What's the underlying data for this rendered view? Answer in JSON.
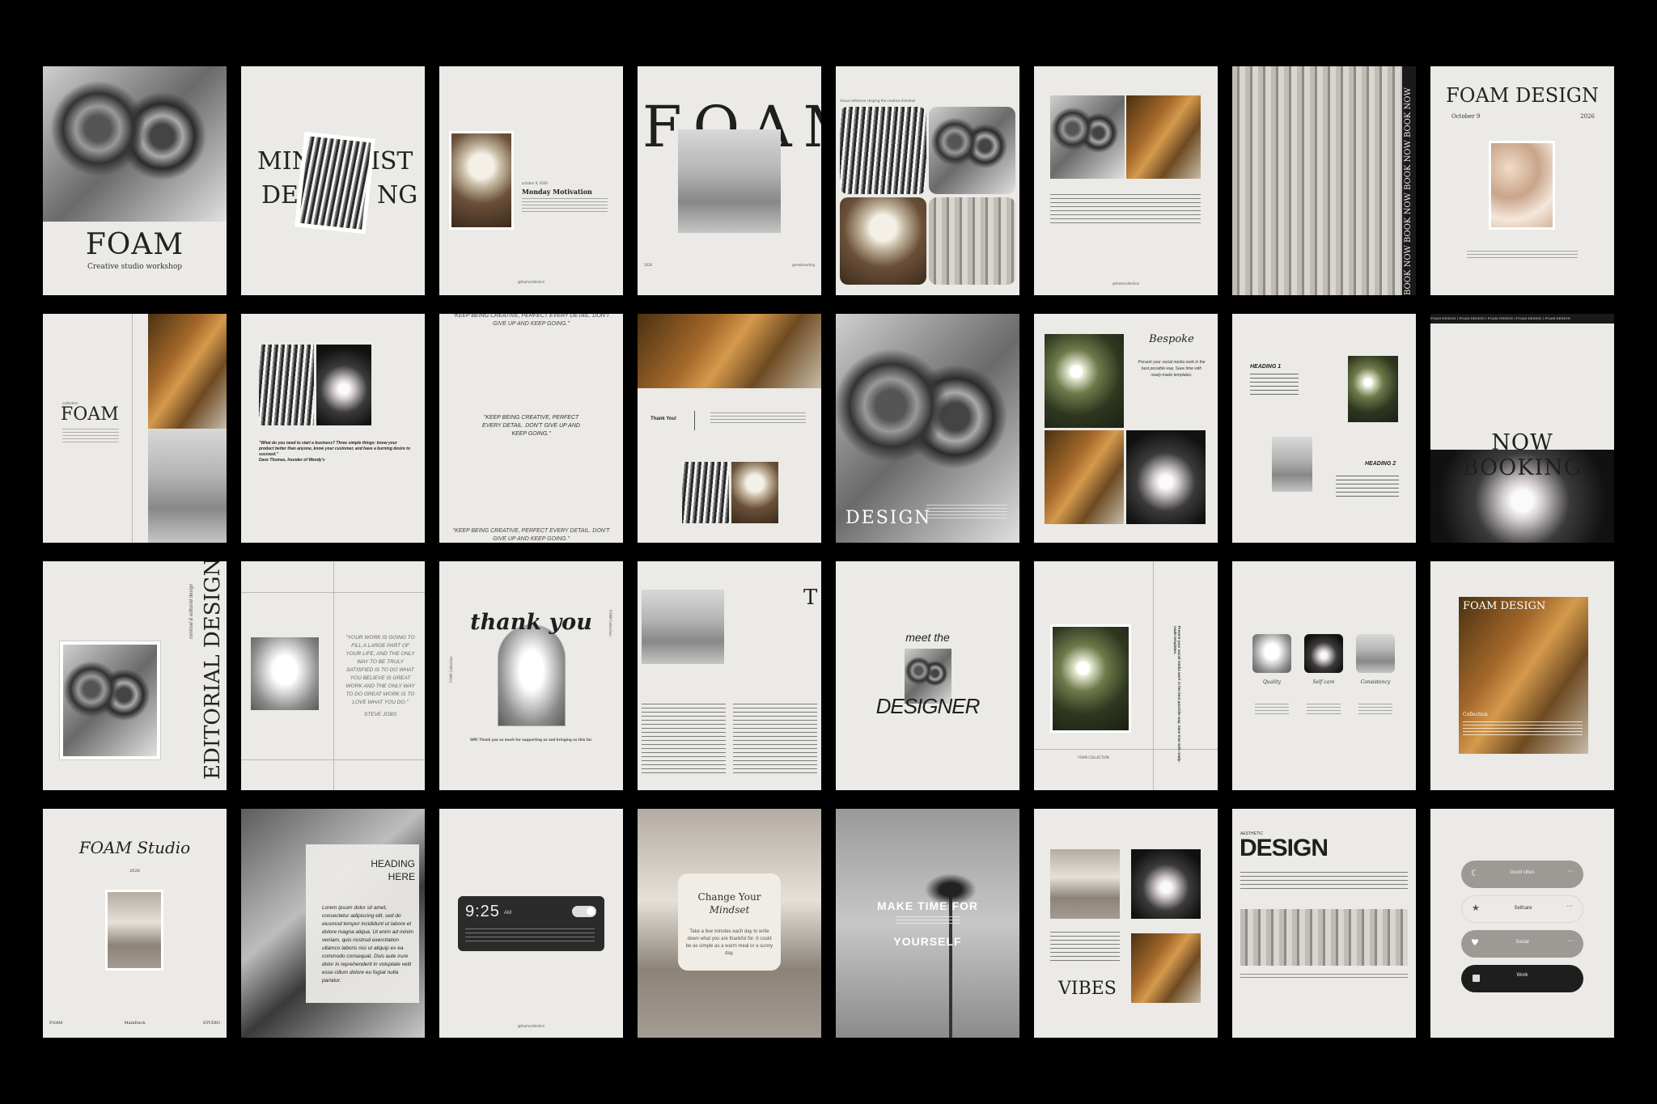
{
  "grid": {
    "rows": [
      [
        {
          "title": "FOAM",
          "subtitle": "Creative studio workshop"
        },
        {
          "word1a": "MIN",
          "word1b": "IST",
          "word2a": "DE",
          "word2b": "NG"
        },
        {
          "date": "october 9, 2026",
          "heading": "Monday Motivation",
          "footer": "@foamcollection"
        },
        {
          "title": "FOAM",
          "year": "2026",
          "handle": "@mebranding"
        },
        {
          "caption": "Visual reference shaping the creative direction"
        },
        {
          "footer": "@foamcollection"
        },
        {
          "side_text": "BOOK NOW  BOOK NOW  BOOK NOW  BOOK NOW"
        },
        {
          "title": "FOAM DESIGN",
          "date": "October 9",
          "year": "2026"
        }
      ],
      [
        {
          "label": "collection",
          "title": "FOAM"
        },
        {
          "quote": "\"What do you need to start a business? Three simple things: know your product better than anyone, know your customer, and have a burning desire to succeed.\"",
          "author": "Dave Thomas, founder of Wendy's"
        },
        {
          "quote_top": "\"KEEP BEING CREATIVE, PERFECT EVERY DETAIL. DON'T GIVE UP AND KEEP GOING.\"",
          "quote_mid": "\"KEEP BEING CREATIVE, PERFECT EVERY DETAIL. DON'T GIVE UP AND KEEP GOING.\"",
          "quote_bottom": "\"KEEP BEING CREATIVE, PERFECT EVERY DETAIL. DON'T GIVE UP AND KEEP GOING.\""
        },
        {
          "thanks": "Thank You!"
        },
        {
          "title": "DESIGN"
        },
        {
          "title": "Bespoke",
          "body": "Present your social media work in the best possible way. Save time with ready-made templates."
        },
        {
          "heading1": "HEADING 1",
          "heading2": "HEADING 2"
        },
        {
          "banner": "FOAM DESIGN | FOAM DESIGN | FOAM DESIGN | FOAM DESIGN | FOAM DESIGN",
          "title": "NOW BOOKING"
        }
      ],
      [
        {
          "small": "minimal & editorial design",
          "title": "EDITORIAL DESIGN"
        },
        {
          "quote": "\"YOUR WORK IS GOING TO FILL A LARGE PART OF YOUR LIFE, AND THE ONLY WAY TO BE TRULY SATISFIED IS TO DO WHAT YOU BELIEVE IS GREAT WORK AND THE ONLY WAY TO DO GREAT WORK IS TO LOVE WHAT YOU DO.\"",
          "author": "STEVE JOBS"
        },
        {
          "title": "thank you",
          "side_left": "FOAM Collection",
          "side_right": "FOAM Collection",
          "note": "SIM! Thank you so much for supporting us and bringing us this far."
        },
        {
          "letter": "T"
        },
        {
          "top": "meet the",
          "title": "DESIGNER"
        },
        {
          "side": "Present your social media work in the best possible way. Save time with ready-made templates.",
          "footer": "FOAM COLLECTION"
        },
        {
          "item1": "Quality",
          "item2": "Self care",
          "item3": "Consistency"
        },
        {
          "title": "FOAM DESIGN",
          "label": "Collection"
        }
      ],
      [
        {
          "title": "FOAM Studio",
          "year": "2026",
          "foot1": "FOAM",
          "foot2": "MainDeck",
          "foot3": "STUDIO"
        },
        {
          "heading": "HEADING HERE",
          "body": "Lorem ipsum dolor sit amet, consectetur adipiscing elit, sed do eiusmod tempor incididunt ut labore et dolore magna aliqua. Ut enim ad minim veniam, quis nostrud exercitation ullamco laboris nisi ut aliquip ex ea commodo consequat. Duis aute irure dolor in reprehenderit in voluptate velit esse cillum dolore eu fugiat nulla pariatur."
        },
        {
          "time": "9:25",
          "ampm": "AM",
          "footer": "@foamcollection"
        },
        {
          "title1": "Change Your",
          "title2": "Mindset",
          "body": "Take a few minutes each day to write down what you are thankful for. It could be as simple as a warm meal or a sunny day."
        },
        {
          "line1": "MAKE TIME FOR",
          "line2": "YOURSELF"
        },
        {
          "title": "VIBES"
        },
        {
          "kicker": "AESTHETIC",
          "title": "DESIGN"
        },
        {
          "pills": [
            {
              "icon": "moon-icon",
              "label": "Good vibes"
            },
            {
              "icon": "star-icon",
              "label": "Selfcare"
            },
            {
              "icon": "heart-icon",
              "label": "Social"
            },
            {
              "icon": "square-icon",
              "label": "Work"
            }
          ]
        }
      ]
    ]
  }
}
